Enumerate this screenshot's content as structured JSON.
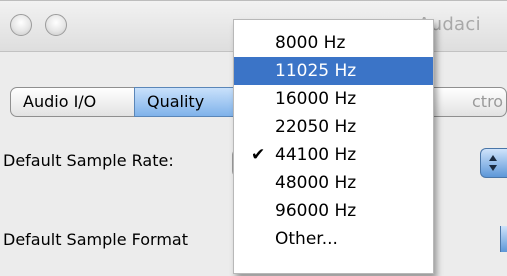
{
  "window": {
    "title_fragment": "Audaci"
  },
  "tabs": [
    {
      "label": "Audio I/O",
      "selected": false
    },
    {
      "label": "Quality",
      "selected": true
    },
    {
      "label": "ctro",
      "selected": false
    }
  ],
  "settings": {
    "sample_rate_label": "Default Sample Rate:",
    "sample_format_label": "Default Sample Format"
  },
  "sample_rate_menu": {
    "items": [
      {
        "label": "8000 Hz",
        "highlighted": false,
        "checked": false
      },
      {
        "label": "11025 Hz",
        "highlighted": true,
        "checked": false
      },
      {
        "label": "16000 Hz",
        "highlighted": false,
        "checked": false
      },
      {
        "label": "22050 Hz",
        "highlighted": false,
        "checked": false
      },
      {
        "label": "44100 Hz",
        "highlighted": false,
        "checked": true
      },
      {
        "label": "48000 Hz",
        "highlighted": false,
        "checked": false
      },
      {
        "label": "96000 Hz",
        "highlighted": false,
        "checked": false
      },
      {
        "label": "Other...",
        "highlighted": false,
        "checked": false
      }
    ],
    "check_glyph": "✔"
  },
  "colors": {
    "menu_highlight": "#3b74c7",
    "tab_selected": "#7fb2ea"
  }
}
